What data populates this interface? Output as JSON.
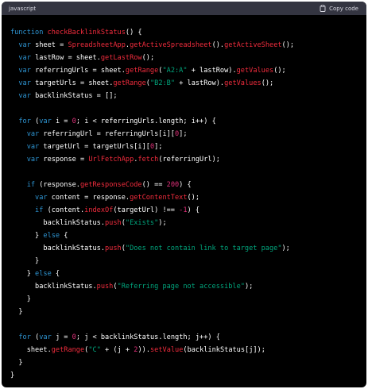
{
  "header": {
    "language": "javascript",
    "copy_label": "Copy code"
  },
  "colors": {
    "keyword": "#2e95d3",
    "function": "#f22c3d",
    "string": "#00a67d",
    "number": "#df3079",
    "plain": "#ffffff",
    "background": "#000000",
    "header_background": "#343541"
  },
  "code_lines": [
    [
      {
        "t": "function ",
        "k": "kw"
      },
      {
        "t": "checkBacklinkStatus",
        "k": "fn"
      },
      {
        "t": "() {",
        "k": "pl"
      }
    ],
    [
      {
        "t": "  ",
        "k": "pl"
      },
      {
        "t": "var",
        "k": "kw"
      },
      {
        "t": " sheet = ",
        "k": "pl"
      },
      {
        "t": "SpreadsheetApp",
        "k": "fn"
      },
      {
        "t": ".",
        "k": "pl"
      },
      {
        "t": "getActiveSpreadsheet",
        "k": "fn"
      },
      {
        "t": "().",
        "k": "pl"
      },
      {
        "t": "getActiveSheet",
        "k": "fn"
      },
      {
        "t": "();",
        "k": "pl"
      }
    ],
    [
      {
        "t": "  ",
        "k": "pl"
      },
      {
        "t": "var",
        "k": "kw"
      },
      {
        "t": " lastRow = sheet.",
        "k": "pl"
      },
      {
        "t": "getLastRow",
        "k": "fn"
      },
      {
        "t": "();",
        "k": "pl"
      }
    ],
    [
      {
        "t": "  ",
        "k": "pl"
      },
      {
        "t": "var",
        "k": "kw"
      },
      {
        "t": " referringUrls = sheet.",
        "k": "pl"
      },
      {
        "t": "getRange",
        "k": "fn"
      },
      {
        "t": "(",
        "k": "pl"
      },
      {
        "t": "\"A2:A\"",
        "k": "str"
      },
      {
        "t": " + lastRow).",
        "k": "pl"
      },
      {
        "t": "getValues",
        "k": "fn"
      },
      {
        "t": "();",
        "k": "pl"
      }
    ],
    [
      {
        "t": "  ",
        "k": "pl"
      },
      {
        "t": "var",
        "k": "kw"
      },
      {
        "t": " targetUrls = sheet.",
        "k": "pl"
      },
      {
        "t": "getRange",
        "k": "fn"
      },
      {
        "t": "(",
        "k": "pl"
      },
      {
        "t": "\"B2:B\"",
        "k": "str"
      },
      {
        "t": " + lastRow).",
        "k": "pl"
      },
      {
        "t": "getValues",
        "k": "fn"
      },
      {
        "t": "();",
        "k": "pl"
      }
    ],
    [
      {
        "t": "  ",
        "k": "pl"
      },
      {
        "t": "var",
        "k": "kw"
      },
      {
        "t": " backlinkStatus = [];",
        "k": "pl"
      }
    ],
    [],
    [
      {
        "t": "  ",
        "k": "pl"
      },
      {
        "t": "for",
        "k": "kw"
      },
      {
        "t": " (",
        "k": "pl"
      },
      {
        "t": "var",
        "k": "kw"
      },
      {
        "t": " i = ",
        "k": "pl"
      },
      {
        "t": "0",
        "k": "num"
      },
      {
        "t": "; i < referringUrls.length; i++) {",
        "k": "pl"
      }
    ],
    [
      {
        "t": "    ",
        "k": "pl"
      },
      {
        "t": "var",
        "k": "kw"
      },
      {
        "t": " referringUrl = referringUrls[i][",
        "k": "pl"
      },
      {
        "t": "0",
        "k": "num"
      },
      {
        "t": "];",
        "k": "pl"
      }
    ],
    [
      {
        "t": "    ",
        "k": "pl"
      },
      {
        "t": "var",
        "k": "kw"
      },
      {
        "t": " targetUrl = targetUrls[i][",
        "k": "pl"
      },
      {
        "t": "0",
        "k": "num"
      },
      {
        "t": "];",
        "k": "pl"
      }
    ],
    [
      {
        "t": "    ",
        "k": "pl"
      },
      {
        "t": "var",
        "k": "kw"
      },
      {
        "t": " response = ",
        "k": "pl"
      },
      {
        "t": "UrlFetchApp",
        "k": "fn"
      },
      {
        "t": ".",
        "k": "pl"
      },
      {
        "t": "fetch",
        "k": "fn"
      },
      {
        "t": "(referringUrl);",
        "k": "pl"
      }
    ],
    [],
    [
      {
        "t": "    ",
        "k": "pl"
      },
      {
        "t": "if",
        "k": "kw"
      },
      {
        "t": " (response.",
        "k": "pl"
      },
      {
        "t": "getResponseCode",
        "k": "fn"
      },
      {
        "t": "() == ",
        "k": "pl"
      },
      {
        "t": "200",
        "k": "num"
      },
      {
        "t": ") {",
        "k": "pl"
      }
    ],
    [
      {
        "t": "      ",
        "k": "pl"
      },
      {
        "t": "var",
        "k": "kw"
      },
      {
        "t": " content = response.",
        "k": "pl"
      },
      {
        "t": "getContentText",
        "k": "fn"
      },
      {
        "t": "();",
        "k": "pl"
      }
    ],
    [
      {
        "t": "      ",
        "k": "pl"
      },
      {
        "t": "if",
        "k": "kw"
      },
      {
        "t": " (content.",
        "k": "pl"
      },
      {
        "t": "indexOf",
        "k": "fn"
      },
      {
        "t": "(targetUrl) !== ",
        "k": "pl"
      },
      {
        "t": "-1",
        "k": "num"
      },
      {
        "t": ") {",
        "k": "pl"
      }
    ],
    [
      {
        "t": "        backlinkStatus.",
        "k": "pl"
      },
      {
        "t": "push",
        "k": "fn"
      },
      {
        "t": "(",
        "k": "pl"
      },
      {
        "t": "\"Exists\"",
        "k": "str"
      },
      {
        "t": ");",
        "k": "pl"
      }
    ],
    [
      {
        "t": "      } ",
        "k": "pl"
      },
      {
        "t": "else",
        "k": "kw"
      },
      {
        "t": " {",
        "k": "pl"
      }
    ],
    [
      {
        "t": "        backlinkStatus.",
        "k": "pl"
      },
      {
        "t": "push",
        "k": "fn"
      },
      {
        "t": "(",
        "k": "pl"
      },
      {
        "t": "\"Does not contain link to target page\"",
        "k": "str"
      },
      {
        "t": ");",
        "k": "pl"
      }
    ],
    [
      {
        "t": "      }",
        "k": "pl"
      }
    ],
    [
      {
        "t": "    } ",
        "k": "pl"
      },
      {
        "t": "else",
        "k": "kw"
      },
      {
        "t": " {",
        "k": "pl"
      }
    ],
    [
      {
        "t": "      backlinkStatus.",
        "k": "pl"
      },
      {
        "t": "push",
        "k": "fn"
      },
      {
        "t": "(",
        "k": "pl"
      },
      {
        "t": "\"Referring page not accessible\"",
        "k": "str"
      },
      {
        "t": ");",
        "k": "pl"
      }
    ],
    [
      {
        "t": "    }",
        "k": "pl"
      }
    ],
    [
      {
        "t": "  }",
        "k": "pl"
      }
    ],
    [],
    [
      {
        "t": "  ",
        "k": "pl"
      },
      {
        "t": "for",
        "k": "kw"
      },
      {
        "t": " (",
        "k": "pl"
      },
      {
        "t": "var",
        "k": "kw"
      },
      {
        "t": " j = ",
        "k": "pl"
      },
      {
        "t": "0",
        "k": "num"
      },
      {
        "t": "; j < backlinkStatus.length; j++) {",
        "k": "pl"
      }
    ],
    [
      {
        "t": "    sheet.",
        "k": "pl"
      },
      {
        "t": "getRange",
        "k": "fn"
      },
      {
        "t": "(",
        "k": "pl"
      },
      {
        "t": "\"C\"",
        "k": "str"
      },
      {
        "t": " + (j + ",
        "k": "pl"
      },
      {
        "t": "2",
        "k": "num"
      },
      {
        "t": ")).",
        "k": "pl"
      },
      {
        "t": "setValue",
        "k": "fn"
      },
      {
        "t": "(backlinkStatus[j]);",
        "k": "pl"
      }
    ],
    [
      {
        "t": "  }",
        "k": "pl"
      }
    ],
    [
      {
        "t": "}",
        "k": "pl"
      }
    ]
  ]
}
